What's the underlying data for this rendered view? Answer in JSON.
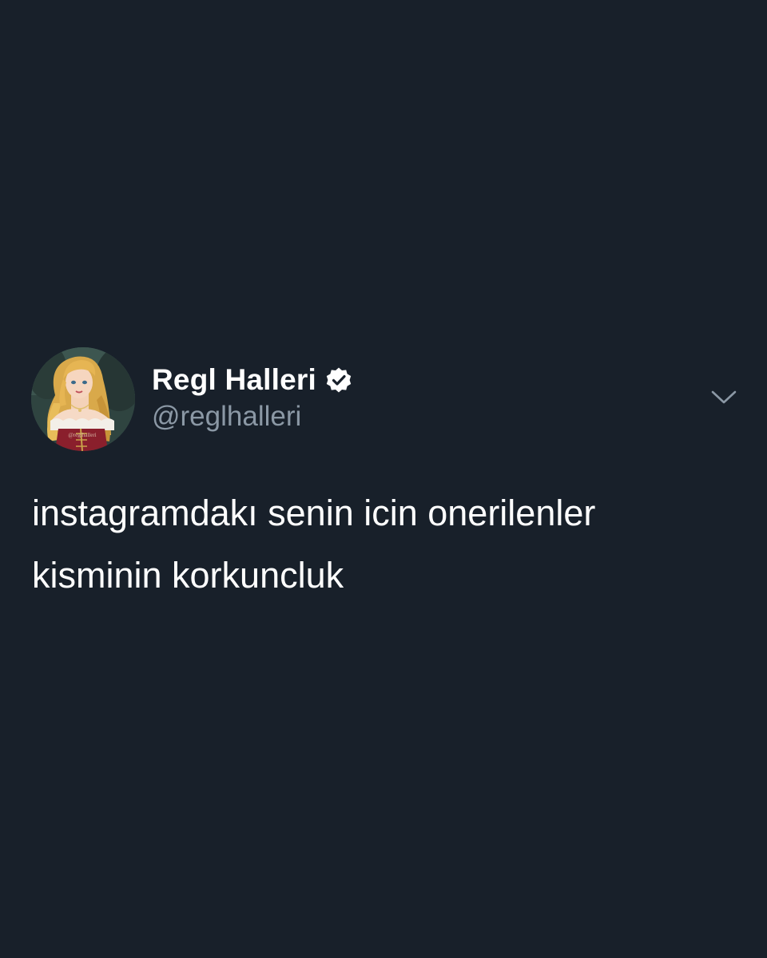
{
  "tweet": {
    "author": {
      "display_name": "Regl Halleri",
      "handle": "@reglhalleri",
      "verified": true,
      "avatar_icon": "illustrated-princess-avatar",
      "avatar_watermark": "@reglhalleri"
    },
    "text_lines": [
      "instagramdakı senin icin onerilenler",
      "kisminin korkuncluk"
    ],
    "menu_icon": "chevron-down-icon"
  },
  "colors": {
    "background": "#18202a",
    "text": "#ffffff",
    "handle": "#8b98a5",
    "verified_badge": "#ffffff"
  }
}
